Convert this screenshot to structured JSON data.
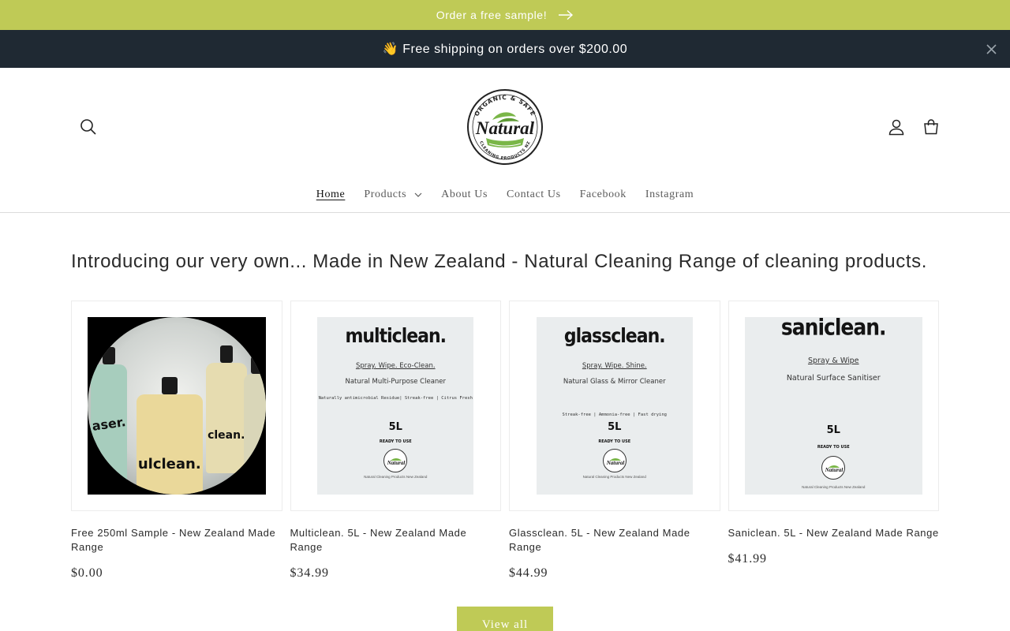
{
  "announcement": {
    "text": "Order a free sample!"
  },
  "shipping_bar": {
    "text": "👋 Free shipping on orders over $200.00"
  },
  "header": {
    "logo": {
      "top_text": "ORGANIC & SAFE",
      "name": "Natural",
      "bottom_text": "CLEANING PRODUCTS NZ"
    }
  },
  "nav": {
    "items": [
      {
        "label": "Home",
        "active": true
      },
      {
        "label": "Products",
        "has_dropdown": true
      },
      {
        "label": "About Us"
      },
      {
        "label": "Contact Us"
      },
      {
        "label": "Facebook"
      },
      {
        "label": "Instagram"
      }
    ]
  },
  "collection": {
    "heading": "Introducing our very own... Made in New Zealand - Natural Cleaning Range of cleaning products.",
    "products": [
      {
        "title": "Free 250ml Sample - New Zealand Made Range",
        "price": "$0.00",
        "image": {
          "bottle_labels": [
            "aser.",
            "ulclean.",
            "clean."
          ]
        }
      },
      {
        "title": "Multiclean. 5L - New Zealand Made Range",
        "price": "$34.99",
        "image": {
          "brand": "multiclean.",
          "tagline": "Spray. Wipe. Eco-Clean.",
          "desc": "Natural Multi-Purpose Cleaner",
          "features": "Naturally antimicrobial Residue| Streak-free | Citrus Fresh",
          "volume": "5L",
          "rtu": "READY TO USE",
          "footer": "Natural Cleaning Products New Zealand"
        }
      },
      {
        "title": "Glassclean. 5L - New Zealand Made Range",
        "price": "$44.99",
        "image": {
          "brand": "glassclean.",
          "tagline": "Spray. Wipe. Shine.",
          "desc": "Natural Glass & Mirror Cleaner",
          "features": "Streak-free | Ammonia-free | Fast drying",
          "volume": "5L",
          "rtu": "READY TO USE",
          "footer": "Natural Cleaning Products New Zealand"
        }
      },
      {
        "title": "Saniclean. 5L - New Zealand Made Range",
        "price": "$41.99",
        "image": {
          "brand": "saniclean.",
          "tagline": "Spray & Wipe",
          "desc": "Natural Surface Sanitiser",
          "volume": "5L",
          "rtu": "READY TO USE",
          "footer": "Natural Cleaning Products New Zealand"
        }
      }
    ],
    "view_all_label": "View all"
  },
  "colors": {
    "accent": "#bfca56",
    "dark_bar": "#1f2933",
    "logo_green": "#7ab648"
  }
}
